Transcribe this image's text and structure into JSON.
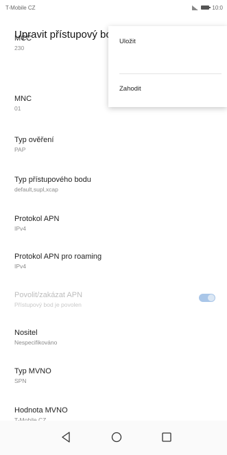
{
  "status_bar": {
    "carrier": "T-Mobile CZ",
    "time": "10:0"
  },
  "app_bar": {
    "title": "Upravit přístupový bod"
  },
  "menu": {
    "items": [
      "Uložit",
      "Zahodit"
    ]
  },
  "settings": [
    {
      "label": "MCC",
      "value": "230"
    },
    {
      "label": "MNC",
      "value": "01"
    },
    {
      "label": "Typ ověření",
      "value": "PAP"
    },
    {
      "label": "Typ přístupového bodu",
      "value": "default,supl,xcap"
    },
    {
      "label": "Protokol APN",
      "value": "IPv4"
    },
    {
      "label": "Protokol APN pro roaming",
      "value": "IPv4"
    },
    {
      "label": "Povolit/zakázat APN",
      "value": "Přístupový bod je povolen",
      "toggle_on": true,
      "disabled": true
    },
    {
      "label": "Nositel",
      "value": "Nespecifikováno"
    },
    {
      "label": "Typ MVNO",
      "value": "SPN"
    },
    {
      "label": "Hodnota MVNO",
      "value": "T-Mobile CZ"
    }
  ],
  "nav": {
    "icons": [
      "back-icon",
      "home-icon",
      "recents-icon"
    ]
  }
}
